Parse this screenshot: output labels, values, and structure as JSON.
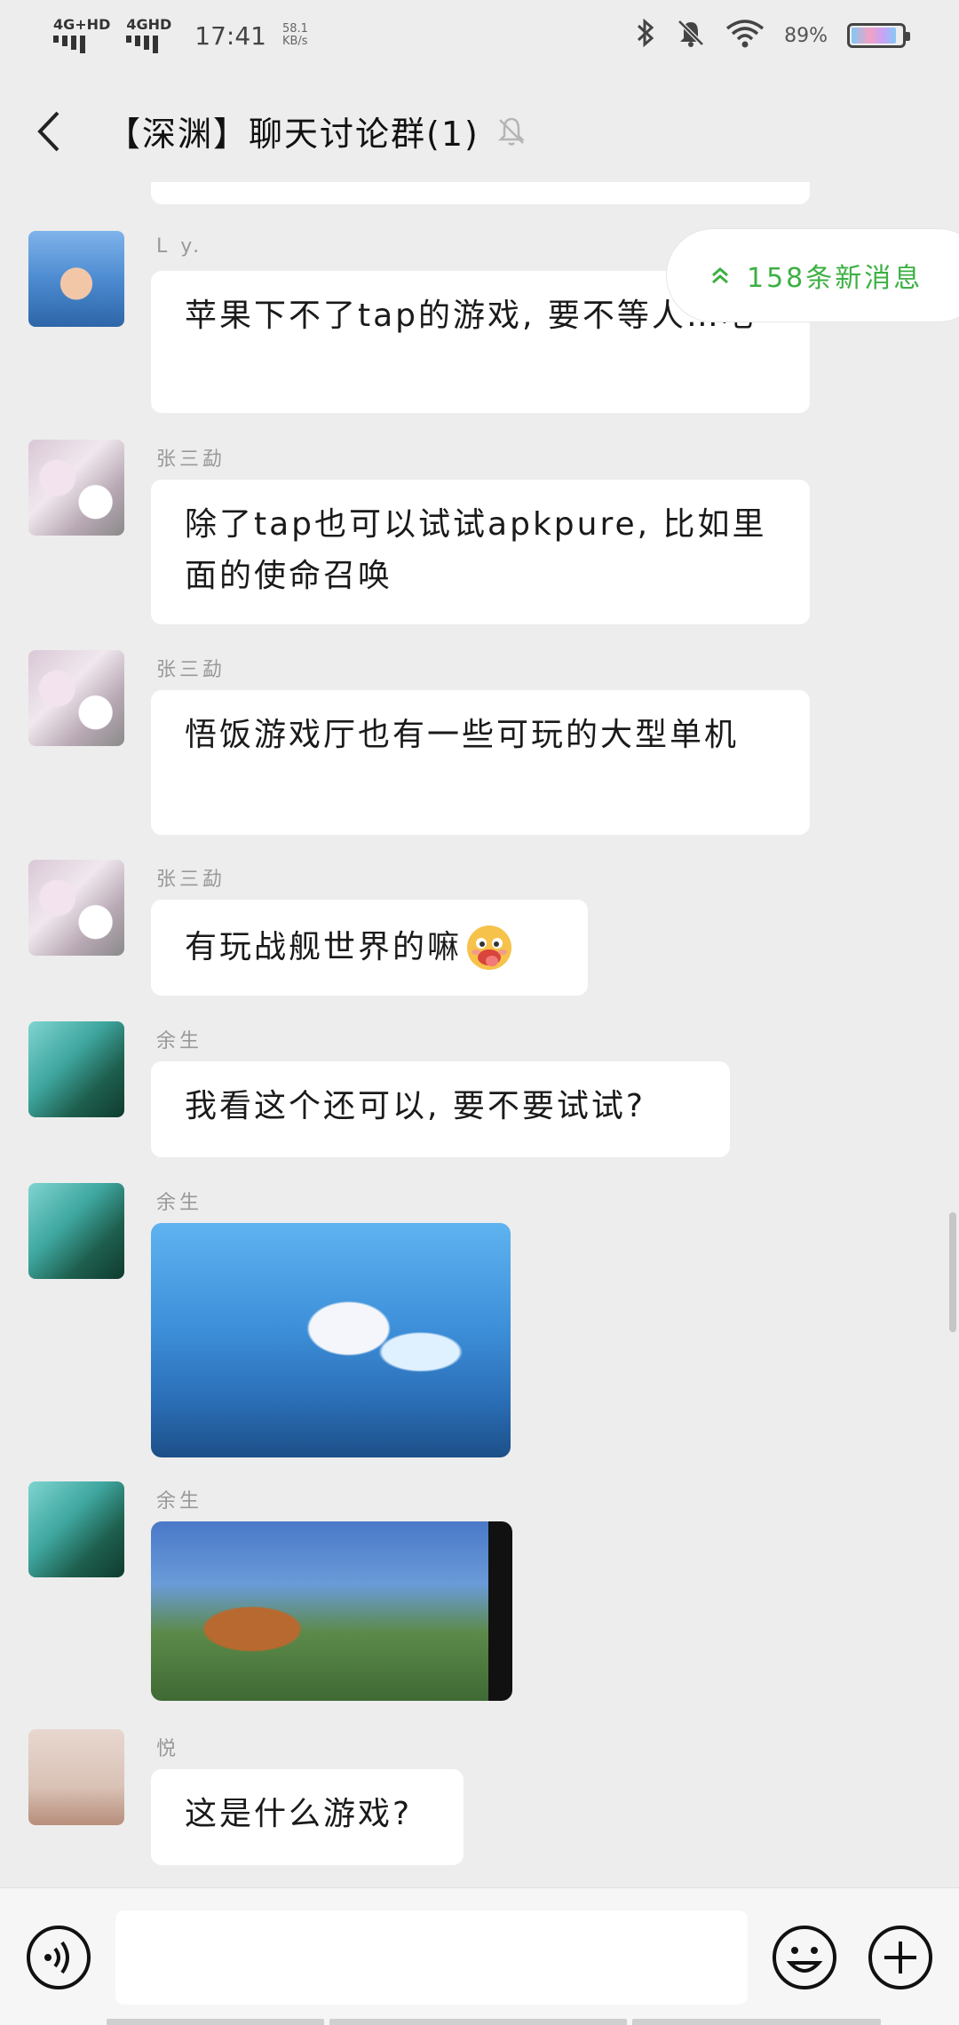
{
  "status_bar": {
    "network1": "4G+HD",
    "network2": "4GHD",
    "time": "17:41",
    "speed_value": "58.1",
    "speed_unit": "KB/s",
    "battery": "89%",
    "battery_level": 0.89
  },
  "header": {
    "title": "【深渊】聊天讨论群(1)"
  },
  "new_messages": {
    "label": "158条新消息",
    "accent": "#3cb043"
  },
  "messages": [
    {
      "sender": "L y.",
      "text": "苹果下不了tap的游戏, 要不等人…吧"
    },
    {
      "sender": "张三勐",
      "text": "除了tap也可以试试apkpure, 比如里面的使命召唤"
    },
    {
      "sender": "张三勐",
      "text": "悟饭游戏厅也有一些可玩的大型单机"
    },
    {
      "sender": "张三勐",
      "text": "有玩战舰世界的嘛"
    },
    {
      "sender": "余生",
      "text": "我看这个还可以, 要不要试试?"
    },
    {
      "sender": "余生",
      "text": ""
    },
    {
      "sender": "余生",
      "text": ""
    },
    {
      "sender": "悦",
      "text": "这是什么游戏?"
    }
  ],
  "input": {
    "placeholder": ""
  }
}
